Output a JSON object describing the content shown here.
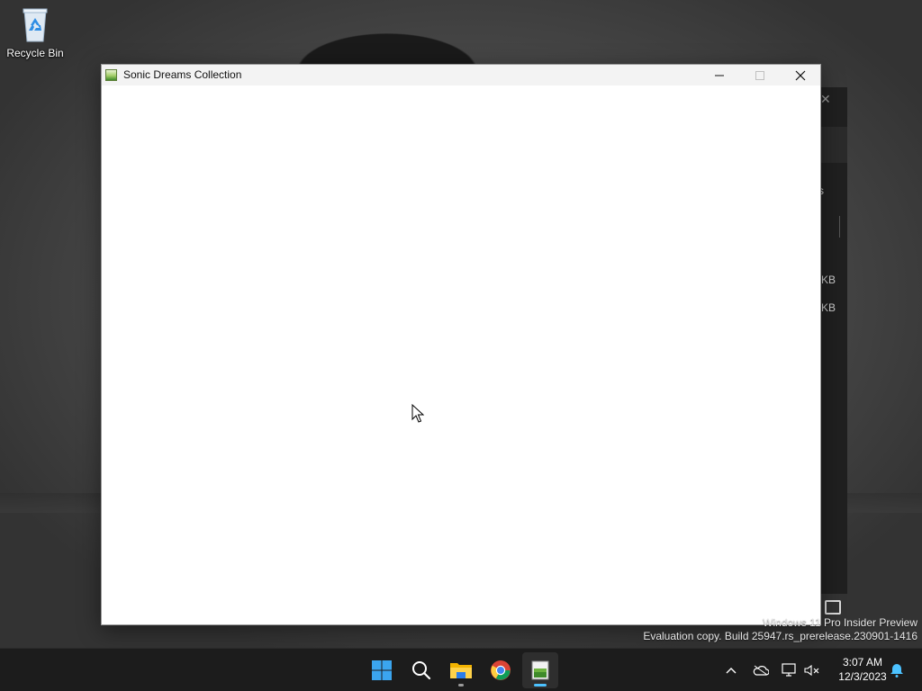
{
  "desktop": {
    "icons": [
      {
        "label": "Recycle Bin",
        "icon": "recycle-bin-icon"
      }
    ]
  },
  "background_window": {
    "fragments": [
      "s",
      "KB",
      "KB"
    ]
  },
  "window": {
    "title": "Sonic Dreams Collection",
    "icon": "app-icon",
    "controls": {
      "minimize": "─",
      "maximize": "☐",
      "close": "✕"
    }
  },
  "watermark": {
    "line1": "Windows 11 Pro Insider Preview",
    "line2": "Evaluation copy. Build 25947.rs_prerelease.230901-1416"
  },
  "taskbar": {
    "apps": [
      {
        "name": "start-button",
        "icon": "windows-logo-icon"
      },
      {
        "name": "search-button",
        "icon": "search-icon"
      },
      {
        "name": "file-explorer",
        "icon": "folder-icon"
      },
      {
        "name": "chrome",
        "icon": "chrome-icon"
      },
      {
        "name": "sonic-dreams-app",
        "icon": "app-icon"
      }
    ],
    "tray": {
      "overflow": "^",
      "icons": [
        "onedrive-icon",
        "network-icon",
        "volume-muted-icon",
        "notification-bell-icon"
      ]
    },
    "clock": {
      "time": "3:07 AM",
      "date": "12/3/2023"
    },
    "accent": "#4cc2ff"
  }
}
